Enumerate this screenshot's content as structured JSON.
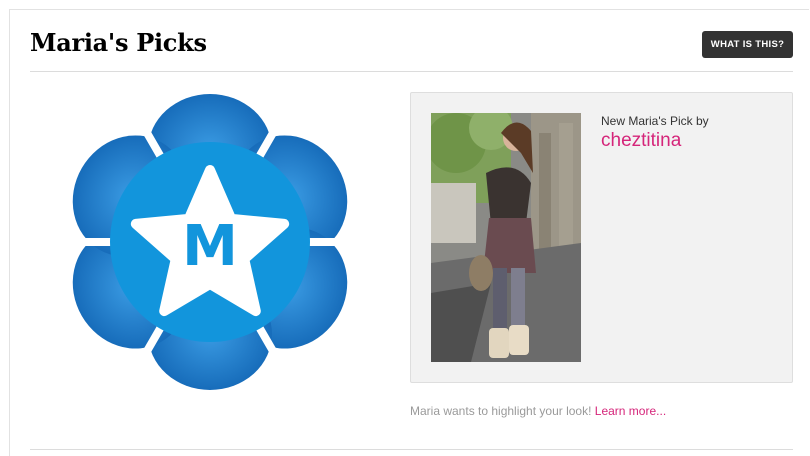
{
  "header": {
    "title": "Maria's Picks",
    "help_button_label": "WHAT IS THIS?"
  },
  "logo": {
    "letter": "M",
    "icon": "flower-star-badge-icon",
    "colors": {
      "petal_dark": "#1169b8",
      "petal_light": "#2f8fd9",
      "disc": "#1295dc",
      "star": "#ffffff",
      "letter": "#1295dc"
    }
  },
  "pick": {
    "intro_text": "New Maria's Pick by",
    "username": "cheztitina",
    "photo_icon": "fashion-photo"
  },
  "footer": {
    "caption_text": "Maria wants to highlight your look!",
    "learn_more_label": "Learn more..."
  },
  "colors": {
    "accent": "#d5257a",
    "button_bg": "#333333",
    "panel_bg": "#f2f2f2"
  }
}
